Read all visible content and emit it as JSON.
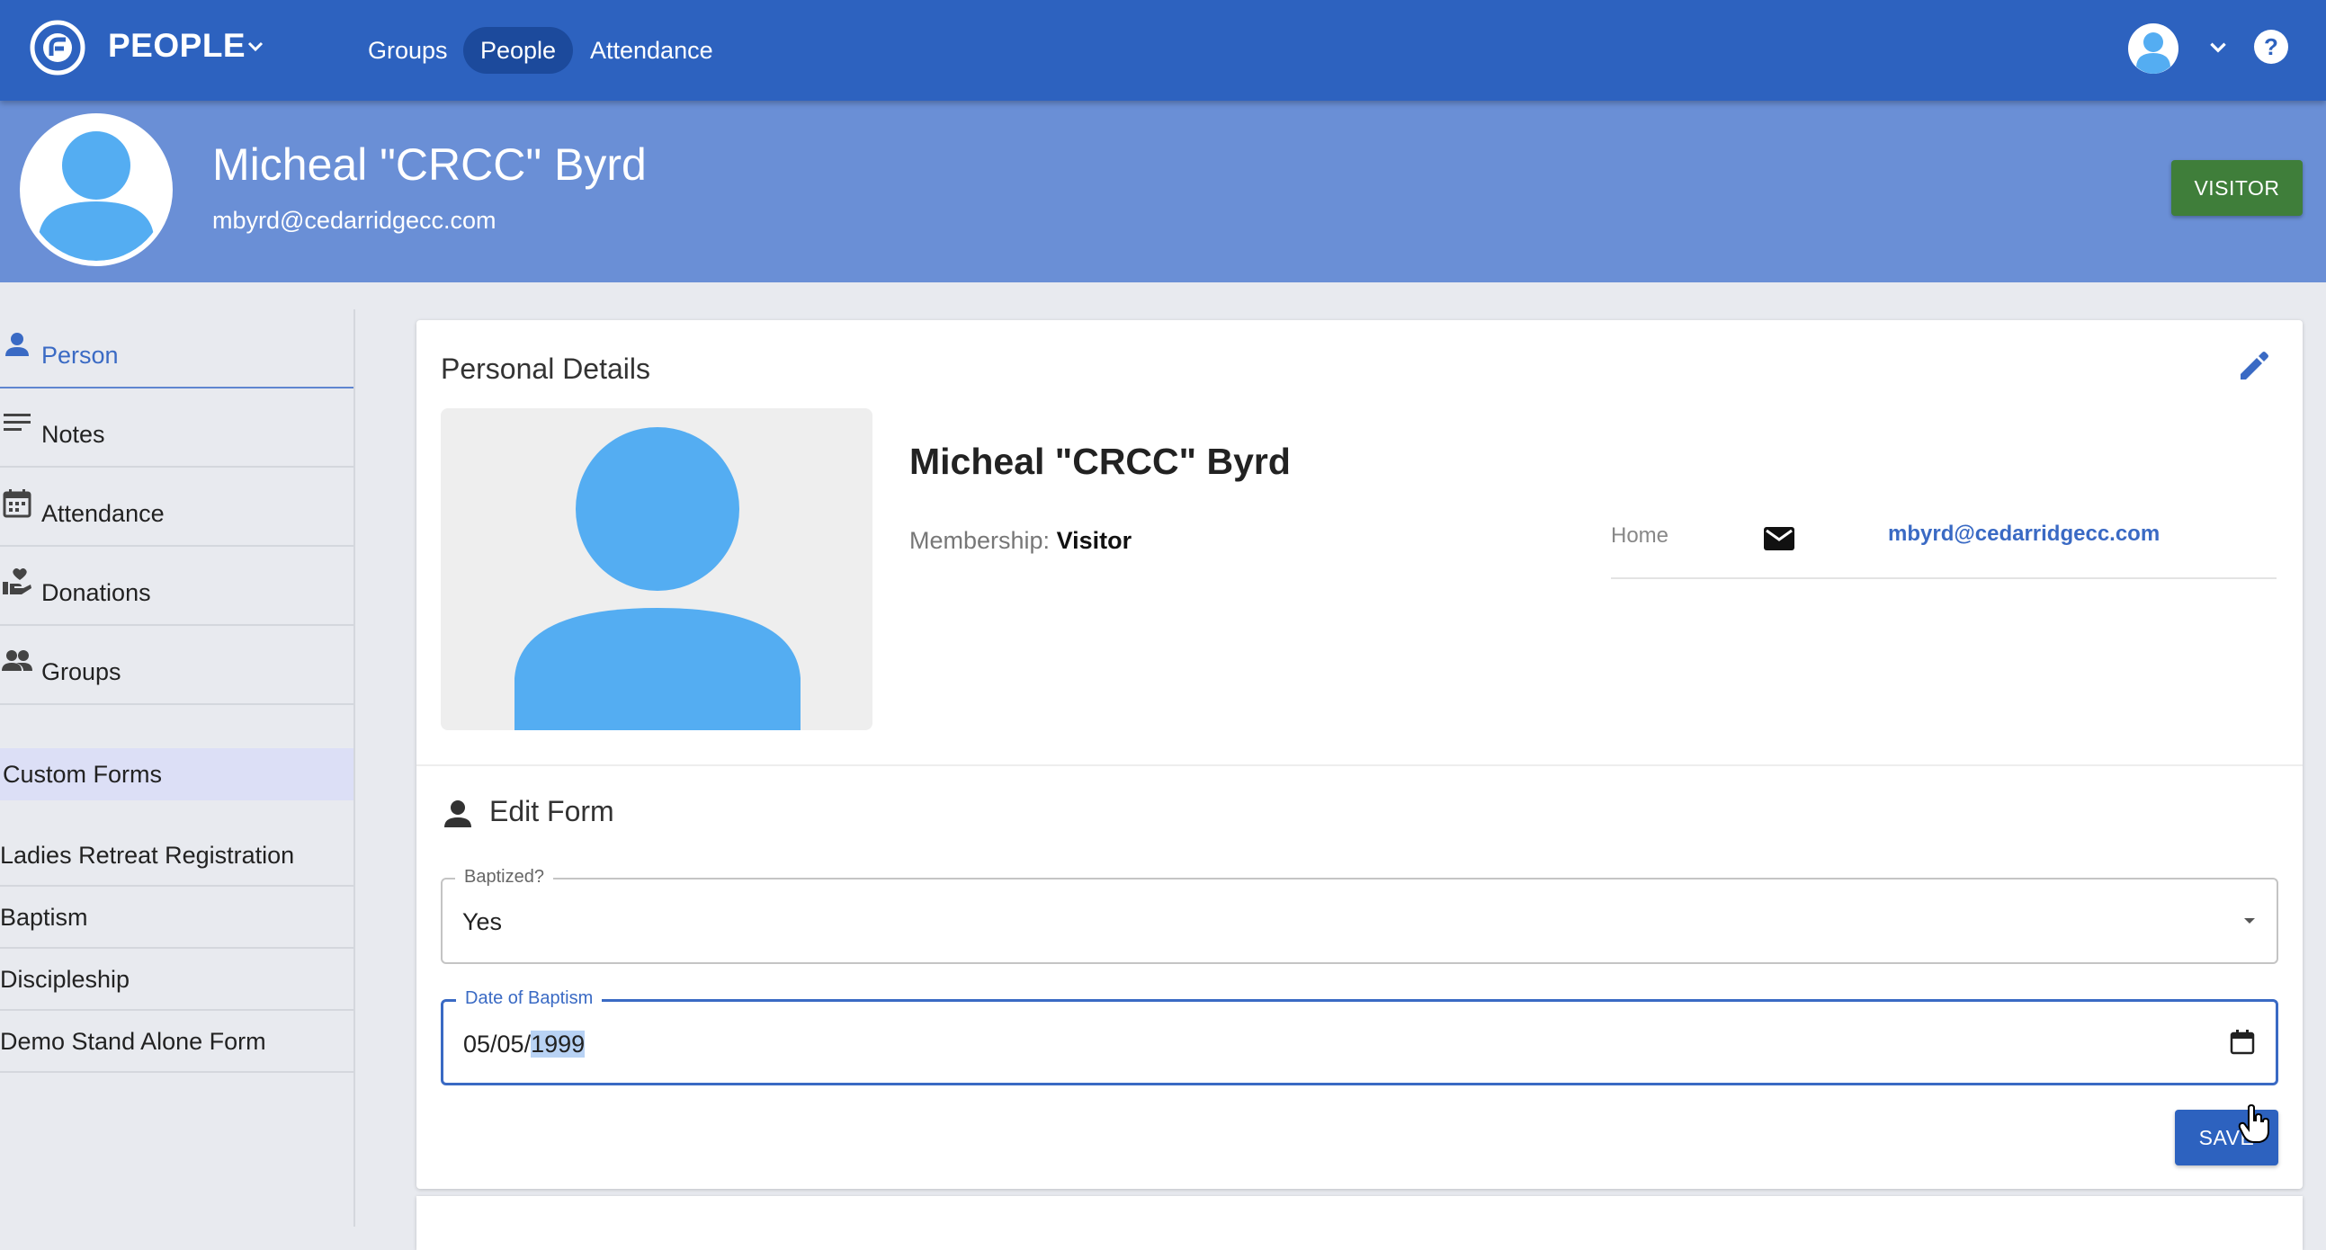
{
  "app": {
    "title": "PEOPLE",
    "nav": [
      {
        "label": "Groups",
        "active": false
      },
      {
        "label": "People",
        "active": true
      },
      {
        "label": "Attendance",
        "active": false
      }
    ]
  },
  "profile": {
    "name": "Micheal \"CRCC\" Byrd",
    "email": "mbyrd@cedarridgecc.com",
    "status_button": "VISITOR"
  },
  "sidebar": {
    "items": [
      {
        "label": "Person",
        "icon": "person-icon",
        "active": true
      },
      {
        "label": "Notes",
        "icon": "notes-icon",
        "active": false
      },
      {
        "label": "Attendance",
        "icon": "calendar-icon",
        "active": false
      },
      {
        "label": "Donations",
        "icon": "donation-icon",
        "active": false
      },
      {
        "label": "Groups",
        "icon": "groups-icon",
        "active": false
      }
    ],
    "custom_forms_header": "Custom Forms",
    "forms": [
      "Ladies Retreat Registration",
      "Baptism",
      "Discipleship",
      "Demo Stand Alone Form"
    ]
  },
  "details": {
    "title": "Personal Details",
    "name": "Micheal \"CRCC\" Byrd",
    "membership_label": "Membership:",
    "membership_value": "Visitor",
    "contact": {
      "type": "Home",
      "email": "mbyrd@cedarridgecc.com"
    }
  },
  "edit_form": {
    "title": "Edit Form",
    "baptized_label": "Baptized?",
    "baptized_value": "Yes",
    "date_label": "Date of Baptism",
    "date_prefix": "05/05/",
    "date_year": "1999",
    "save_label": "SAVE"
  },
  "colors": {
    "topbar": "#2d62bf",
    "header": "#6a8fd6",
    "accent": "#3a6ac4",
    "visitor": "#3f7e3a",
    "avatar": "#54adf2"
  }
}
